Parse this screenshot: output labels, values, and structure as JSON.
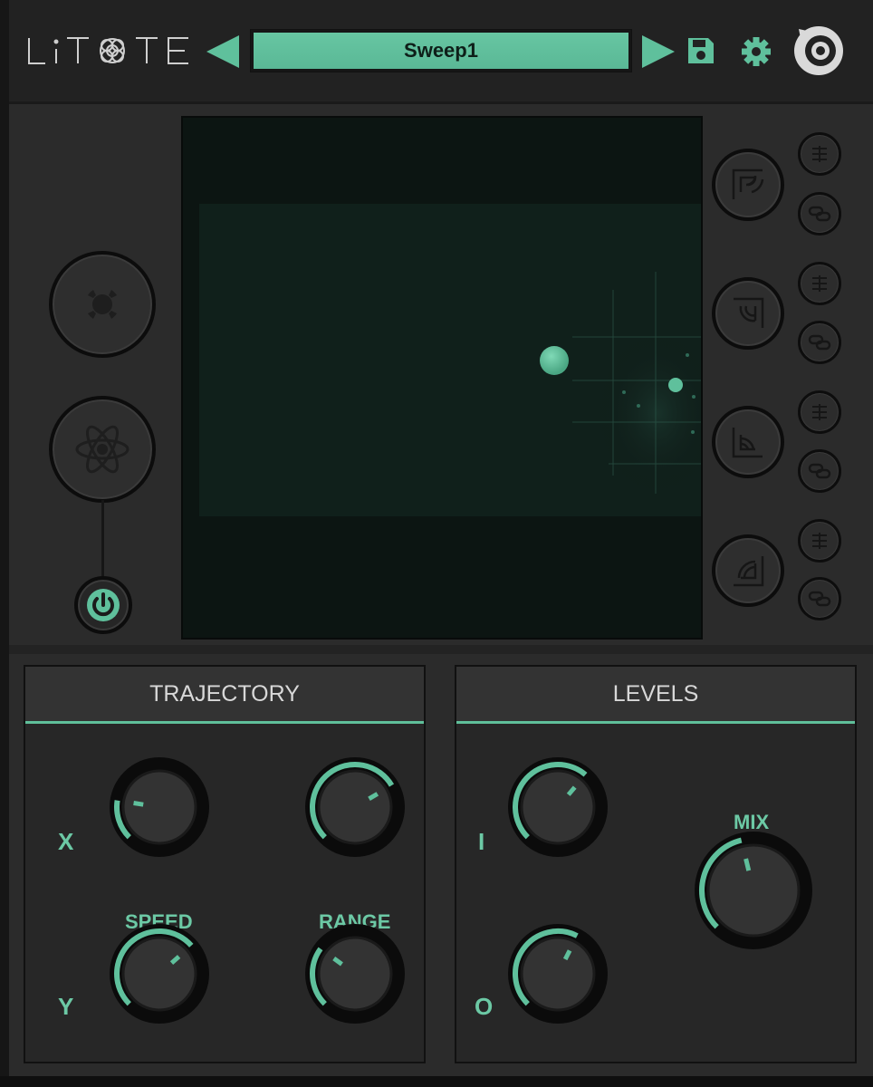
{
  "header": {
    "logo_text": "LiTOTE",
    "preset_name": "Sweep1",
    "prev_icon": "triangle-left-icon",
    "next_icon": "triangle-right-icon",
    "save_icon": "floppy-disk-icon",
    "settings_icon": "gear-icon",
    "brand_icon": "brand-logo-icon"
  },
  "left_controls": [
    {
      "name": "mode-orbit-button",
      "icon": "orbit-icon"
    },
    {
      "name": "mode-atom-button",
      "icon": "atom-icon"
    },
    {
      "name": "power-button",
      "icon": "power-icon",
      "state": "on"
    }
  ],
  "xy_pad": {
    "main_node_color": "#5fc09c"
  },
  "right_controls": [
    {
      "shape": "reverb-shape-1",
      "icons": [
        "sliders-icon",
        "link-icon"
      ]
    },
    {
      "shape": "reverb-shape-2",
      "icons": [
        "sliders-icon",
        "link-icon"
      ]
    },
    {
      "shape": "reverb-shape-3",
      "icons": [
        "sliders-icon",
        "link-icon"
      ]
    },
    {
      "shape": "reverb-shape-4",
      "icons": [
        "sliders-icon",
        "link-icon"
      ]
    }
  ],
  "trajectory": {
    "title": "TRAJECTORY",
    "x_label": "X",
    "y_label": "Y",
    "speed_label": "SPEED",
    "range_label": "RANGE",
    "knobs": {
      "speed_x": 0.2,
      "range_x": 0.72,
      "speed_y": 0.68,
      "range_y": 0.3
    }
  },
  "levels": {
    "title": "LEVELS",
    "i_label": "I",
    "o_label": "O",
    "mix_label": "MIX",
    "knobs": {
      "input": 0.65,
      "output": 0.6,
      "mix": 0.45
    }
  },
  "colors": {
    "accent": "#5fc09c",
    "panel_bg": "#2b2b2b",
    "pad_bg": "#0d1613"
  }
}
